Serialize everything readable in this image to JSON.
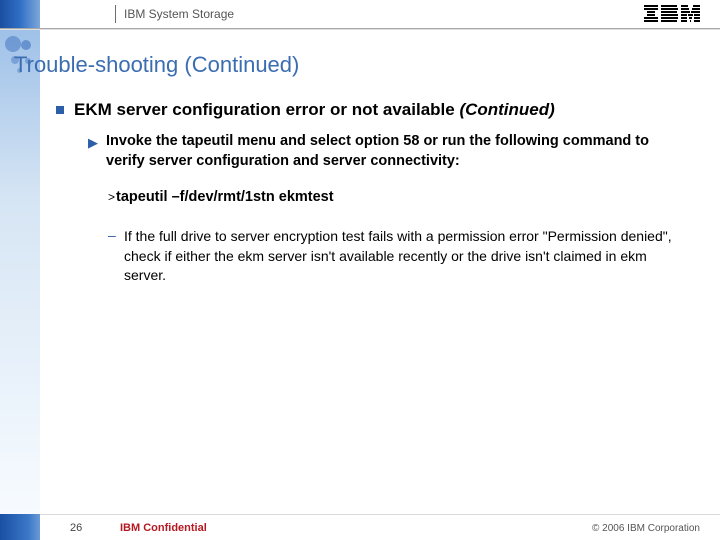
{
  "header": {
    "product": "IBM System Storage",
    "logo": "ibm-logo"
  },
  "title": "Trouble-shooting (Continued)",
  "content": {
    "h1_main": "EKM server configuration error or not available ",
    "h1_suffix": "(Continued)",
    "step": "Invoke the tapeutil menu and select option 58 or run the following command to verify server configuration and server connectivity:",
    "command_prefix": ">",
    "command": "tapeutil –f/dev/rmt/1stn ekmtest",
    "note": "If the full drive to server encryption test fails with a permission error \"Permission denied\", check if either the ekm server isn't available recently or the drive isn't claimed in ekm server."
  },
  "footer": {
    "page": "26",
    "confidential": "IBM Confidential",
    "copyright": "© 2006 IBM Corporation"
  }
}
